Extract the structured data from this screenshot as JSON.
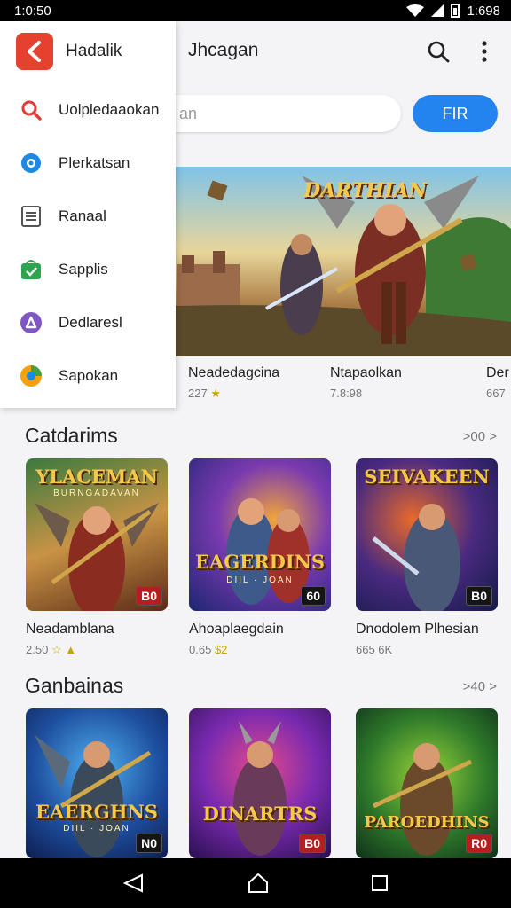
{
  "status_bar": {
    "time": "1:0:50",
    "battery_text": "1:698"
  },
  "app_bar": {
    "title": "Jhcagan"
  },
  "search": {
    "placeholder": "an",
    "button_label": "FIR"
  },
  "banner": {
    "title": "DARTHIAN"
  },
  "featured": [
    {
      "name": "Neadedagcina",
      "meta": "227",
      "star": "★"
    },
    {
      "name": "Ntapaolkan",
      "meta": "7.8:98"
    },
    {
      "name": "Der",
      "meta": "667"
    }
  ],
  "sections": [
    {
      "title": "Catdarims",
      "see_all": ">00 >",
      "cards": [
        {
          "thumb_title": "YLACEMAN",
          "thumb_sub": "BURNGADAVAN",
          "badge": "B0",
          "name": "Neadamblana",
          "meta": "2.50",
          "rating_glyphs": "☆ ▲"
        },
        {
          "thumb_title": "EAGERDINS",
          "thumb_sub": "DIIL · JOAN",
          "badge": "60",
          "name": "Ahoaplaegdain",
          "meta": "0.65",
          "rating_glyphs": "$2"
        },
        {
          "thumb_title": "SEIVAKEEN",
          "thumb_sub": "",
          "badge": "B0",
          "name": "Dnodolem Plhesian",
          "meta": "665 6K"
        }
      ]
    },
    {
      "title": "Ganbainas",
      "see_all": ">40 >",
      "cards": [
        {
          "thumb_title": "EAERGHNS",
          "thumb_sub": "DIIL · JOAN",
          "badge": "N0"
        },
        {
          "thumb_title": "DINARTRS",
          "thumb_sub": "",
          "badge": "B0"
        },
        {
          "thumb_title": "PAROEDHINS",
          "thumb_sub": "",
          "badge": "R0"
        }
      ]
    }
  ],
  "drawer": {
    "app_name": "Hadalik",
    "items": [
      {
        "label": "Uolpledaaokan",
        "icon": "search-icon",
        "color": "#e53935"
      },
      {
        "label": "Plerkatsan",
        "icon": "settings-icon",
        "color": "#1e88e5"
      },
      {
        "label": "Ranaal",
        "icon": "list-icon",
        "color": "#555555"
      },
      {
        "label": "Sapplis",
        "icon": "shopping-bag-icon",
        "color": "#2ea44f"
      },
      {
        "label": "Dedlaresl",
        "icon": "shield-icon",
        "color": "#7e57c2"
      },
      {
        "label": "Sapokan",
        "icon": "globe-icon",
        "color": "#f2a20a"
      }
    ]
  },
  "colors": {
    "accent": "#2383ef",
    "drawer_brand": "#e6402f"
  }
}
